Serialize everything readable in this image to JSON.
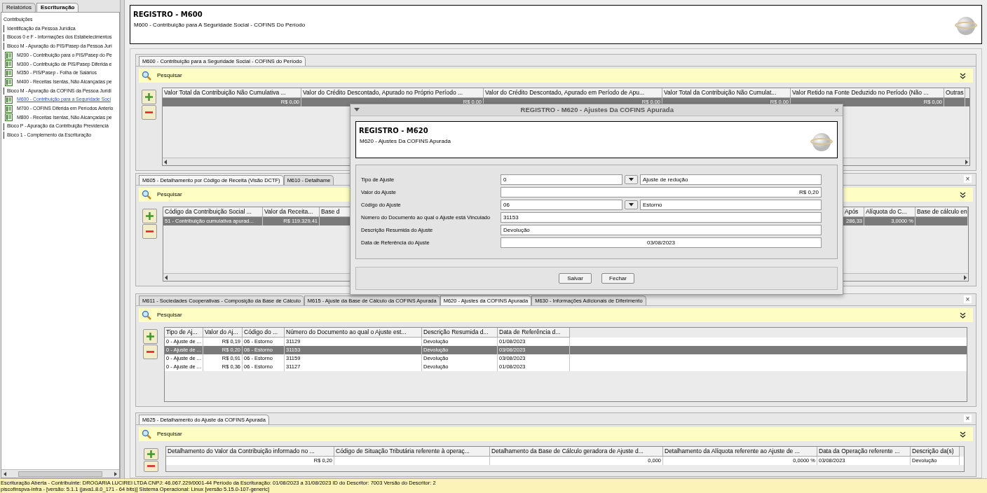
{
  "sidebar": {
    "tabs": [
      {
        "label": "Relatórios",
        "selected": false
      },
      {
        "label": "Escrituração",
        "selected": true
      }
    ],
    "tree": [
      {
        "label": "Contribuições",
        "kind": "root",
        "selected": false,
        "children": [
          {
            "label": "Identificação da Pessoa Jurídica",
            "kind": "group",
            "selected": false
          },
          {
            "label": "Blocos 0 e F - Informações dos Estabelecimentos",
            "kind": "group",
            "selected": false
          },
          {
            "label": "Bloco M - Apuração do PIS/Pasep da Pessoa Jurí",
            "kind": "group",
            "selected": false,
            "children": [
              {
                "label": "M200 - Contribuição para o PIS/Pasep do Pe",
                "kind": "record",
                "selected": false
              },
              {
                "label": "M300 - Contribuição de PIS/Pasep Diferida e",
                "kind": "record",
                "selected": false
              },
              {
                "label": "M350 - PIS/Pasep - Folha de Salários",
                "kind": "record",
                "selected": false
              },
              {
                "label": "M400 - Receitas Isentas, Não Alcançadas pe",
                "kind": "record",
                "selected": false
              }
            ]
          },
          {
            "label": "Bloco M - Apuração da COFINS da Pessoa Jurídi",
            "kind": "group",
            "selected": false,
            "children": [
              {
                "label": "M600 - Contribuição para a Seguridade Soci",
                "kind": "record",
                "selected": true
              },
              {
                "label": "M700 - COFINS Diferida em Períodos Anterio",
                "kind": "record",
                "selected": false
              },
              {
                "label": "M800 - Receitas Isentas, Não Alcançadas pe",
                "kind": "record",
                "selected": false
              }
            ]
          },
          {
            "label": "Bloco P - Apuração da Contribuição Previdenciá",
            "kind": "group",
            "selected": false
          },
          {
            "label": "Bloco 1 - Complemento da Escrituração",
            "kind": "group",
            "selected": false
          }
        ]
      }
    ]
  },
  "header": {
    "title": "REGISTRO - M600",
    "subtitle": "M600 - Contribuição para A Seguridade Social - COFINS Do Período"
  },
  "panels": [
    {
      "tabs": [
        {
          "label": "M600 - Contribuição para a Seguridade Social - COFINS do Período",
          "selected": true
        }
      ],
      "search": "Pesquisar",
      "table": {
        "columns": [
          "Valor Total da Contribuição Não Cumulativa ...",
          "Valor do Crédito Descontado, Apurado no Próprio Período ...",
          "Valor do Crédito Descontado, Apurado em Período de Apu...",
          "Valor Total da Contribuição Não Cumulat...",
          "Valor Retido na Fonte Deduzido no Período (Não ...",
          "Outras"
        ],
        "rows": [
          {
            "cells": [
              "R$ 0,00",
              "R$ 0,00",
              "R$ 0,00",
              "R$ 0,00",
              "R$ 0,00",
              ""
            ],
            "selected": true
          }
        ]
      }
    },
    {
      "tabs": [
        {
          "label": "M605 - Detalhamento por Código de Receita (Visão DCTF)",
          "selected": true
        },
        {
          "label": "M610 - Detalhame",
          "selected": false
        }
      ],
      "close": "×",
      "search": "Pesquisar",
      "table": {
        "columns": [
          "Código da Contribuição Social ...",
          "Valor da Receita...",
          "Base d",
          "Após",
          "Alíquota do C...",
          "Base de cálculo en"
        ],
        "rows": [
          {
            "cells": [
              "51 - Contribuição cumulativa apurad...",
              "R$ 119.329,41",
              "",
              "286,33",
              "3,0000 %",
              ""
            ],
            "selected": true
          }
        ]
      }
    },
    {
      "tabs": [
        {
          "label": "M611 - Sociedades Cooperativas - Composição da Base de Cálculo",
          "selected": false
        },
        {
          "label": "M615 - Ajuste da Base de Cálculo da COFINS Apurada",
          "selected": false
        },
        {
          "label": "M620 - Ajustes da COFINS Apurada",
          "selected": true
        },
        {
          "label": "M630 - Informações Adicionais de Diferimento",
          "selected": false
        }
      ],
      "close": "×",
      "search": "Pesquisar",
      "table": {
        "columns": [
          "Tipo de Aj...",
          "Valor do Aj...",
          "Código do ...",
          "Número do Documento ao qual o Ajuste est...",
          "Descrição Resumida d...",
          "Data de Referência d..."
        ],
        "rows": [
          {
            "cells": [
              "0 - Ajuste de ...",
              "R$ 0,19",
              "06 - Estorno",
              "31129",
              "Devolução",
              "01/08/2023"
            ],
            "selected": false
          },
          {
            "cells": [
              "0 - Ajuste de ...",
              "R$ 0,20",
              "06 - Estorno",
              "31153",
              "Devolução",
              "03/08/2023"
            ],
            "selected": true
          },
          {
            "cells": [
              "0 - Ajuste de ...",
              "R$ 0,91",
              "06 - Estorno",
              "31159",
              "Devolução",
              "03/08/2023"
            ],
            "selected": false
          },
          {
            "cells": [
              "0 - Ajuste de ...",
              "R$ 0,36",
              "06 - Estorno",
              "31127",
              "Devolução",
              "01/08/2023"
            ],
            "selected": false
          }
        ]
      }
    },
    {
      "tabs": [
        {
          "label": "M625 - Detalhamento do Ajuste da COFINS Apurada",
          "selected": true
        }
      ],
      "close": "×",
      "search": "Pesquisar",
      "table": {
        "columns": [
          "Detalhamento do Valor da Contribuição informado no ...",
          "Código de Situação Tributária referente à operaç...",
          "Detalhamento da Base de Cálculo geradora de Ajuste d...",
          "Detalhamento da Alíquota referente ao Ajuste de ...",
          "Data da Operação referente ...",
          "Descrição da(s)"
        ],
        "rows": [
          {
            "cells": [
              "R$ 0,20",
              "",
              "0,000",
              "0,0000 %",
              "03/08/2023",
              "Devolução"
            ],
            "selected": false
          }
        ]
      }
    }
  ],
  "dialog": {
    "title": "REGISTRO - M620 - Ajustes Da COFINS Apurada",
    "close": "×",
    "header": {
      "title": "REGISTRO - M620",
      "subtitle": "M620 - Ajustes Da COFINS Apurada"
    },
    "fields": [
      {
        "label": "Tipo de Ajuste",
        "kind": "combo",
        "value": "0",
        "description": "Ajuste de redução"
      },
      {
        "label": "Valor do Ajuste",
        "kind": "money",
        "value": "R$ 0,20"
      },
      {
        "label": "Código do Ajuste",
        "kind": "combo",
        "value": "06",
        "description": "Estorno"
      },
      {
        "label": "Número do Documento ao qual o Ajuste está Vinculado",
        "kind": "text",
        "value": "31153"
      },
      {
        "label": "Descrição Resumida do Ajuste",
        "kind": "text",
        "value": "Devolução"
      },
      {
        "label": "Data de Referência do Ajuste",
        "kind": "date",
        "value": "03/08/2023"
      }
    ],
    "buttons": [
      "Salvar",
      "Fechar"
    ]
  },
  "status_bar": [
    "Escrituração Aberta - Contribuinte: DROGARIA LUCIREI LTDA CNPJ: 46.067.229/0001-44 Período da Escrituração: 01/08/2023 a 31/08/2023 ID do Descritor: 7003 Versão do Descritor: 2",
    "piscofinspva-infra - [versão: 5.1.1 (java1.8.0_171 - 64 bits)] Sistema Operacional: Linux [versão 5.15.0-107-generic]"
  ]
}
